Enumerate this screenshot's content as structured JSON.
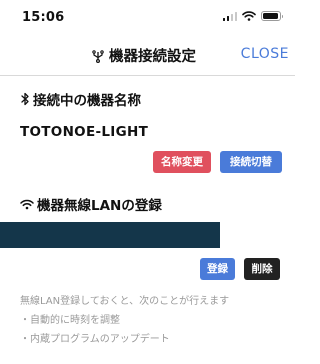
{
  "status_bar": {
    "time": "15:06"
  },
  "header": {
    "title": "機器接続設定",
    "close_label": "CLOSE",
    "icon": "usb-icon"
  },
  "connected_device": {
    "heading": "接続中の機器名称",
    "heading_icon": "bluetooth-icon",
    "device_name": "TOTONOE-LIGHT",
    "rename_label": "名称変更",
    "switch_label": "接続切替"
  },
  "wireless_lan": {
    "heading": "機器無線LANの登録",
    "heading_icon": "wifi-icon",
    "register_label": "登録",
    "delete_label": "削除",
    "info_lines": [
      "無線LAN登録しておくと、次のことが行えます",
      "・自動的に時刻を調整",
      "・内蔵プログラムのアップデート"
    ]
  },
  "colors": {
    "accent_blue": "#4a7bd9",
    "danger_red": "#e0505e",
    "dark_button": "#222222",
    "ssid_bar": "#14364a",
    "info_gray": "#9a9a9a"
  }
}
